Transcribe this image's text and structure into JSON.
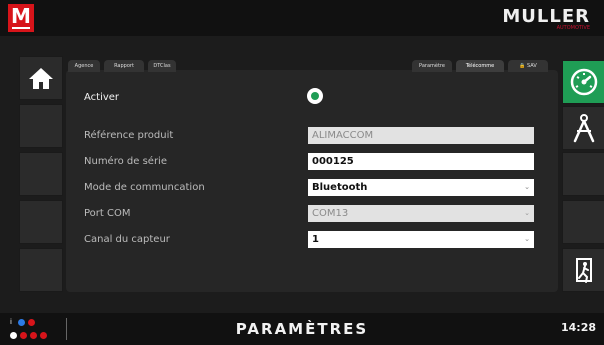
{
  "header": {
    "brand_name": "MULLER",
    "brand_sub": "AUTOMOTIVE",
    "logo_letter": "M"
  },
  "tabs": [
    "Agence",
    "Rapport",
    "DTClas",
    "Paramètre",
    "Télécomme",
    "SAV"
  ],
  "form": {
    "activer_label": "Activer",
    "ref_label": "Référence produit",
    "ref_value": "ALIMACCOM",
    "serial_label": "Numéro de série",
    "serial_value": "000125",
    "mode_label": "Mode de communcation",
    "mode_value": "Bluetooth",
    "port_label": "Port COM",
    "port_value": "COM13",
    "canal_label": "Canal du capteur",
    "canal_value": "1"
  },
  "footer": {
    "title": "PARAMÈTRES",
    "time": "14:28"
  },
  "colors": {
    "accent_green": "#1f9d55",
    "brand_red": "#d7141a"
  },
  "icons": [
    "home-icon",
    "speedometer-icon",
    "compass-icon",
    "exit-icon"
  ]
}
